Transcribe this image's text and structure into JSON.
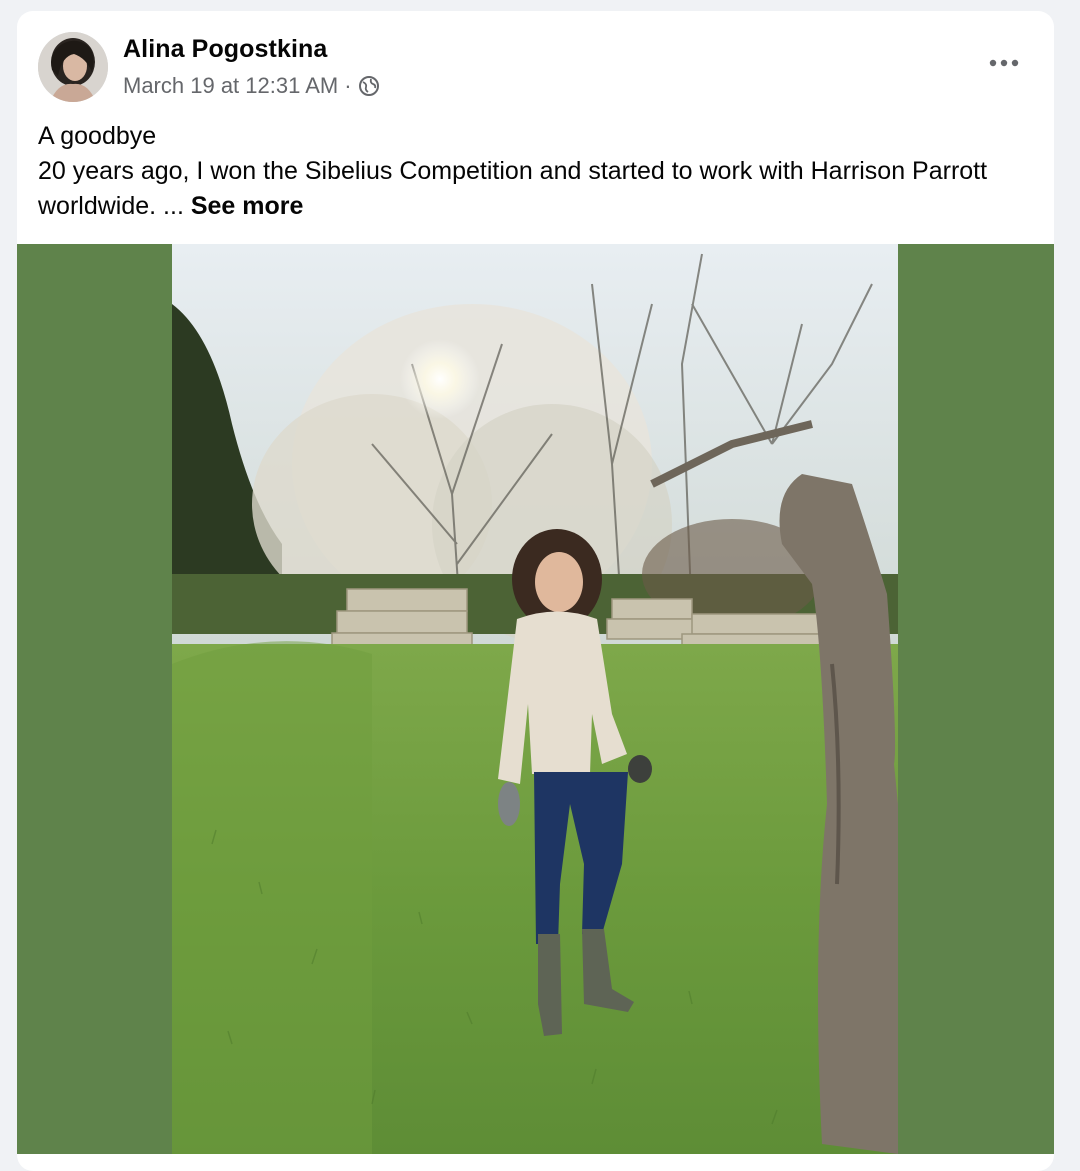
{
  "post": {
    "author_name": "Alina Pogostkina",
    "timestamp": "March 19 at 12:31 AM",
    "separator": "·",
    "audience_icon": "globe-icon",
    "options_icon": "more-options-icon",
    "text_line_1": "A goodbye",
    "text_line_2": "20 years ago, I won the Sibelius Competition and started to work with Harrison Parrott worldwide.",
    "ellipsis": " ... ",
    "see_more_label": "See more"
  },
  "media": {
    "side_color": "#5f834b",
    "photo_kind": "photo-woman-in-garden"
  }
}
